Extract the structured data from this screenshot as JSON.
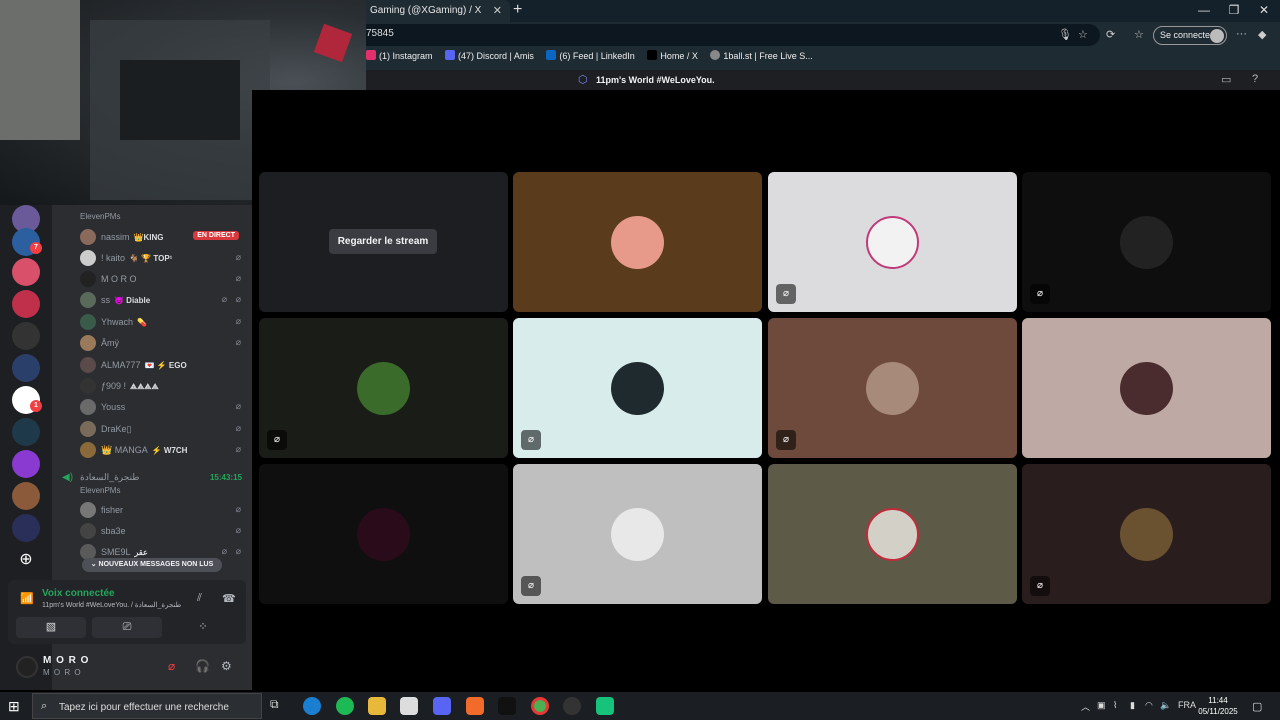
{
  "browser": {
    "tab_title": "Gaming (@XGaming) / X",
    "tab_close": "✕",
    "new_tab": "+",
    "address": "75845",
    "sign_in": "Se connecter",
    "bookmarks": [
      {
        "label": "(1) Instagram",
        "color": "#e1306c"
      },
      {
        "label": "(47) Discord | Amis",
        "color": "#5865f2"
      },
      {
        "label": "(6) Feed | LinkedIn",
        "color": "#0a66c2"
      },
      {
        "label": "Home / X",
        "color": "#000000"
      },
      {
        "label": "1ball.st | Free Live S...",
        "color": "#888888"
      }
    ]
  },
  "header": {
    "channel_title": "11pm's World #WeLoveYou."
  },
  "sidebar": {
    "channel_sub": "ElevenPMs",
    "members": [
      {
        "name": "nassim",
        "tag": "👑KING",
        "live": "EN DIRECT"
      },
      {
        "name": "! kaito",
        "tag": "🐐 🏆 TOP¹"
      },
      {
        "name": "M O R O",
        "tag": ""
      },
      {
        "name": "ss",
        "tag": "😈 Diable"
      },
      {
        "name": "Yhwach",
        "tag": "💊"
      },
      {
        "name": "Āmÿ",
        "tag": ""
      },
      {
        "name": "ALMA777",
        "tag": "💌 ⚡ EGO"
      },
      {
        "name": "ƒ909 !",
        "tag": "⟁⟁⟁⟁"
      },
      {
        "name": "Youss",
        "tag": ""
      },
      {
        "name": "DraKe▯",
        "tag": ""
      },
      {
        "name": "👑 MANGA",
        "tag": "⚡ W7CH"
      }
    ],
    "channel2": {
      "name": "طنجرة_السعادة",
      "time": "15:43:15",
      "sub": "ElevenPMs"
    },
    "members2": [
      {
        "name": "fisher",
        "tag": ""
      },
      {
        "name": "sba3e",
        "tag": ""
      },
      {
        "name": "SME9L",
        "tag": "عقر"
      }
    ],
    "new_messages": "⌄ NOUVEAUX MESSAGES NON LUS"
  },
  "voice": {
    "status": "Voix connectée",
    "channel": "11pm's World #WeLoveYou. / طنجرة_السعادة"
  },
  "user": {
    "name": "M O R O",
    "status": "M O R O"
  },
  "stage": {
    "watch_stream": "Regarder le stream",
    "tiles": [
      {
        "bg": "#5a3b1c",
        "pic": "#e89a8a",
        "muted": false
      },
      {
        "bg": "#dcdcde",
        "pic": "#f2f2f2",
        "muted": true
      },
      {
        "bg": "#0e0e0e",
        "pic": "#222222",
        "muted": true
      },
      {
        "bg": "#1a1c17",
        "pic": "#3b6b2a",
        "muted": true,
        "deafened": true
      },
      {
        "bg": "#d8ecec",
        "pic": "#1f2a2e",
        "muted": true
      },
      {
        "bg": "#6e4a3c",
        "pic": "#a88a7a",
        "muted": true
      },
      {
        "bg": "#bfa9a4",
        "pic": "#4a2b2e",
        "muted": false
      },
      {
        "bg": "#0f0f10",
        "pic": "#2a0b1a",
        "muted": false
      },
      {
        "bg": "#bfbfbf",
        "pic": "#e8e8e8",
        "muted": true
      },
      {
        "bg": "#5e5a48",
        "pic": "#d3d0c8",
        "muted": false
      },
      {
        "bg": "#2a1d1d",
        "pic": "#6a5230",
        "muted": true
      }
    ]
  },
  "taskbar": {
    "search_placeholder": "Tapez ici pour effectuer une recherche",
    "lang": "FRA",
    "time": "11:44",
    "date": "05/11/2025"
  }
}
